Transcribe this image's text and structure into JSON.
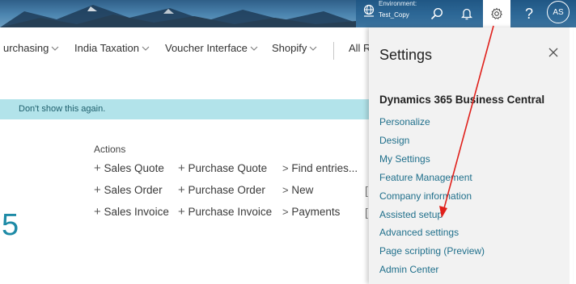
{
  "header": {
    "environment_label": "Environment:",
    "environment_value": "Test_Copy",
    "avatar_initials": "AS",
    "help_glyph": "?",
    "icons": [
      "environment-icon",
      "search-icon",
      "bell-icon",
      "gear-icon",
      "help-icon"
    ]
  },
  "nav": {
    "items": [
      {
        "label": "urchasing"
      },
      {
        "label": "India Taxation"
      },
      {
        "label": "Voucher Interface"
      },
      {
        "label": "Shopify"
      },
      {
        "label": "All R"
      }
    ]
  },
  "notification": {
    "text": "Don't show this again."
  },
  "actions": {
    "title": "Actions",
    "new_items": [
      "Sales Quote",
      "Sales Order",
      "Sales Invoice",
      "Purchase Quote",
      "Purchase Order",
      "Purchase Invoice"
    ],
    "links": [
      "Find entries...",
      "New",
      "Payments"
    ],
    "bracket_glyph": "["
  },
  "tile": {
    "value": "5"
  },
  "settings_panel": {
    "title": "Settings",
    "heading": "Dynamics 365 Business Central",
    "links": [
      "Personalize",
      "Design",
      "My Settings",
      "Feature Management",
      "Company information",
      "Assisted setup",
      "Advanced settings",
      "Page scripting (Preview)",
      "Admin Center"
    ]
  },
  "colors": {
    "accent": "#1f6f8b",
    "notification_bg": "#b2e3ea",
    "annotation_arrow": "#e0201b"
  }
}
